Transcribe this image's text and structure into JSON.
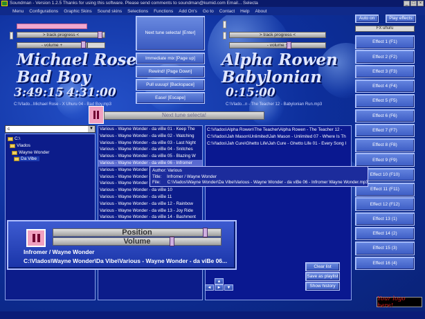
{
  "window": {
    "title": "Soundman - Version 1.2.5 Thanks for using this software. Please send comments to soundman@kumid.com Email... Selecta"
  },
  "menu": [
    "Menu",
    "Configurations",
    "Graphic Skins",
    "Sound skins",
    "Selections",
    "Functions",
    "Add On's",
    "Go to",
    "Contact",
    "Help",
    "About"
  ],
  "left_deck": {
    "progress_label": "> track progress <",
    "volume_label": "- volume +",
    "artist": "Michael Rose",
    "track": "Bad Boy",
    "position_time": "3:49:15",
    "total_time": "4:31:00",
    "path": "C:\\Vlado...Michael Rose - X Uhuru  04 - Bad Boy.mp3"
  },
  "right_deck": {
    "progress_label": "> track progress <",
    "volume_label": "- volume +",
    "artist": "Alpha Rowen",
    "track": "Babylonian",
    "position_time": "0:15:00",
    "path": "C:\\Vlado...n - The Teacher  12 - Babylonian Run.mp3"
  },
  "center_buttons": {
    "next_tune": "Next tune selecta! [Enter]",
    "immediate_mix": "Immediate mix [Page up]",
    "rewind": "Rewind! [Page Down]",
    "pull_up": "Pull uuuup! [Backspace]",
    "ease": "Ease! [Escape]"
  },
  "next_tune_bar": "Next tune selecta!",
  "top_right": {
    "auto_on": "Auto on",
    "play_effects": "Play effects",
    "fx_select": "FX uhuru"
  },
  "effects": [
    "Effect 1 (F1)",
    "Effect 2 (F2)",
    "Effect 3 (F3)",
    "Effect 4 (F4)",
    "Effect 5 (F5)",
    "Effect 6 (F6)",
    "Effect 7 (F7)",
    "Effect 8 (F8)",
    "Effect 9 (F9)",
    "Effect 10 (F10)",
    "Effect 11 (F11)",
    "Effect 12 (F12)",
    "Effect 13 (1)",
    "Effect 14 (2)",
    "Effect 15 (3)",
    "Effect 16 (4)"
  ],
  "drive": "c",
  "tree": [
    "C:\\",
    "Vlados",
    "Wayne Wonder",
    "Da Vibe"
  ],
  "file_list": [
    "Various - Wayne Wonder - da viBe  01 - Keep The",
    "Various - Wayne Wonder - da viBe  02 - Watching",
    "Various - Wayne Wonder - da viBe  03 - Last Night",
    "Various - Wayne Wonder - da viBe  04 - Snitches",
    "Various - Wayne Wonder - da viBe  05 - Blazing W",
    "Various - Wayne Wonder - da viBe  06 - Infromer",
    "Various - Wayne Wonder - da viBe  07 - Let Your",
    "Various - Wayne Wonder - da viBe  08",
    "Various - Wayne Wonder - da viBe  09",
    "Various - Wayne Wonder - da viBe  10",
    "Various - Wayne Wonder - da viBe  11",
    "Various - Wayne Wonder - da viBe  12 - Rainbow",
    "Various - Wayne Wonder - da viBe  13 - Joy Ride",
    "Various - Wayne Wonder - da viBe  14 - Bashment"
  ],
  "playlist": [
    "C:\\Vlados\\Alpha Rowen\\The Teacher\\Alpha Rowen - The Teacher  12 -",
    "C:\\Vlados\\Jah Mason\\Unlimited\\Jah Mason - Unlimited  07 - Where Is Th",
    "C:\\Vlados\\Jah Cure\\Ghetto Life\\Jah Cure - Ghetto Life  01 - Every Song I"
  ],
  "tooltip": {
    "author_label": "Author:",
    "author": "Various",
    "title_label": "Title:",
    "title": "Infromer / Wayne Wonder",
    "file_label": "File:",
    "file": "C:\\Vlados\\Wayne Wonder\\Da Vibe\\Various - Wayne Wonder - da viBe  06 - Infromer  Wayne Wonder.mp3"
  },
  "preview": {
    "position_label": "Position",
    "volume_label": "Volume",
    "title": "Infromer / Wayne Wonder",
    "path": "C:\\Vlados\\Wayne Wonder\\Da Vibe\\Various - Wayne Wonder - da viBe  06..."
  },
  "playlist_buttons": {
    "clear": "Clear list",
    "save": "Save as playlist",
    "show": "Show history"
  },
  "logo": "Your logo here!"
}
